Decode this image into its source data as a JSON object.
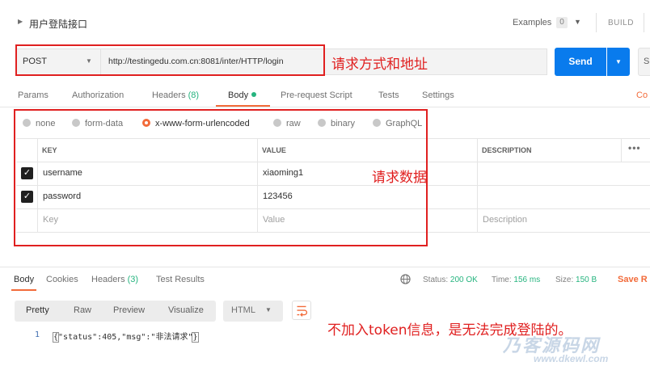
{
  "title": {
    "text": "用户登陆接口",
    "examples_label": "Examples",
    "examples_count": "0",
    "build_label": "BUILD"
  },
  "request": {
    "method": "POST",
    "url": "http://testingedu.com.cn:8081/inter/HTTP/login",
    "send_label": "Send",
    "save_label": "S"
  },
  "tabs": {
    "params": "Params",
    "authorization": "Authorization",
    "headers": "Headers",
    "headers_count": "(8)",
    "body": "Body",
    "prerequest": "Pre-request Script",
    "tests": "Tests",
    "settings": "Settings",
    "cookies": "Co"
  },
  "body_types": [
    "none",
    "form-data",
    "x-www-form-urlencoded",
    "raw",
    "binary",
    "GraphQL"
  ],
  "body_type_selected": "x-www-form-urlencoded",
  "table": {
    "headers": {
      "key": "KEY",
      "value": "VALUE",
      "description": "DESCRIPTION",
      "more": "•••"
    },
    "rows": [
      {
        "checked": true,
        "key": "username",
        "value": "xiaoming1"
      },
      {
        "checked": true,
        "key": "password",
        "value": "123456"
      }
    ],
    "placeholder": {
      "key": "Key",
      "value": "Value",
      "description": "Description"
    }
  },
  "response": {
    "tabs": {
      "body": "Body",
      "cookies": "Cookies",
      "headers": "Headers",
      "headers_count": "(3)",
      "tests": "Test Results"
    },
    "status_label": "Status:",
    "status_value": "200 OK",
    "time_label": "Time:",
    "time_value": "156 ms",
    "size_label": "Size:",
    "size_value": "150 B",
    "save_label": "Save R",
    "formats": {
      "pretty": "Pretty",
      "raw": "Raw",
      "preview": "Preview",
      "visualize": "Visualize"
    },
    "language": "HTML",
    "line_number": "1",
    "code_open": "{",
    "code_inner": "\"status\":405,\"msg\":\"非法请求\"",
    "code_close": "}"
  },
  "annotations": {
    "url": "请求方式和地址",
    "body": "请求数据",
    "response": "不加入token信息，是无法完成登陆的。"
  },
  "watermark": {
    "big": "乃客源码网",
    "url": "www.dkewl.com"
  },
  "colors": {
    "accent": "#f26b3a",
    "send": "#097bed",
    "success": "#26b47f",
    "annotation": "#e02020"
  },
  "icons": {
    "globe": "globe-icon",
    "wrap": "wrap-lines-icon",
    "caret": "chevron-down-icon",
    "check": "checkbox-icon"
  }
}
